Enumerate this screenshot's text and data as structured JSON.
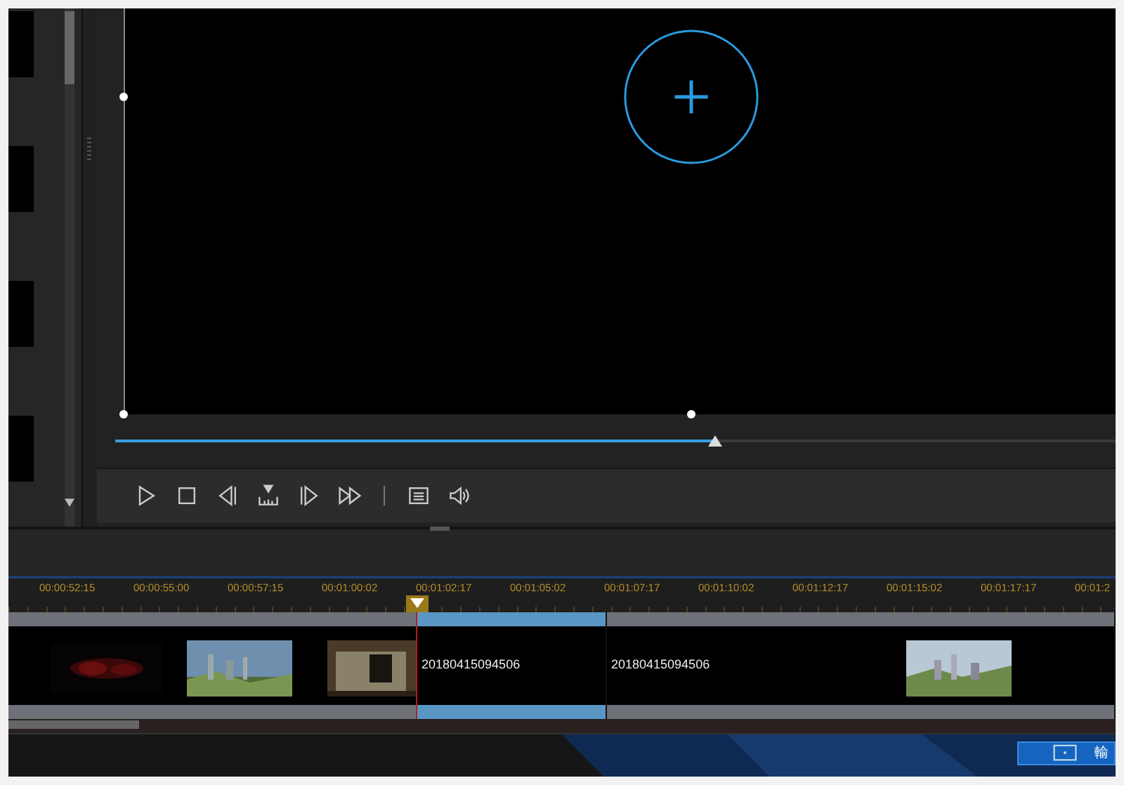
{
  "preview": {
    "scrubber": {
      "level": 0.6
    }
  },
  "controls": [
    {
      "kind": "play"
    },
    {
      "kind": "stop"
    },
    {
      "kind": "previous-frame"
    },
    {
      "kind": "marker"
    },
    {
      "kind": "next-frame"
    },
    {
      "kind": "fast-forward"
    },
    {
      "kind": "separator"
    },
    {
      "kind": "list"
    },
    {
      "kind": "volume"
    }
  ],
  "ruler": {
    "times": [
      "00:00:52:15",
      "00:00:55:00",
      "00:00:57:15",
      "00:01:00:02",
      "00:01:02:17",
      "00:01:05:02",
      "00:01:07:17",
      "00:01:10:02",
      "00:01:12:17",
      "00:01:15:02",
      "00:01:17:17",
      "00:01:2"
    ]
  },
  "clips": [
    {
      "label": "20180415094506",
      "selected": true
    },
    {
      "label": "20180415094506",
      "selected": false
    }
  ],
  "export_button": {
    "label": "輸"
  }
}
